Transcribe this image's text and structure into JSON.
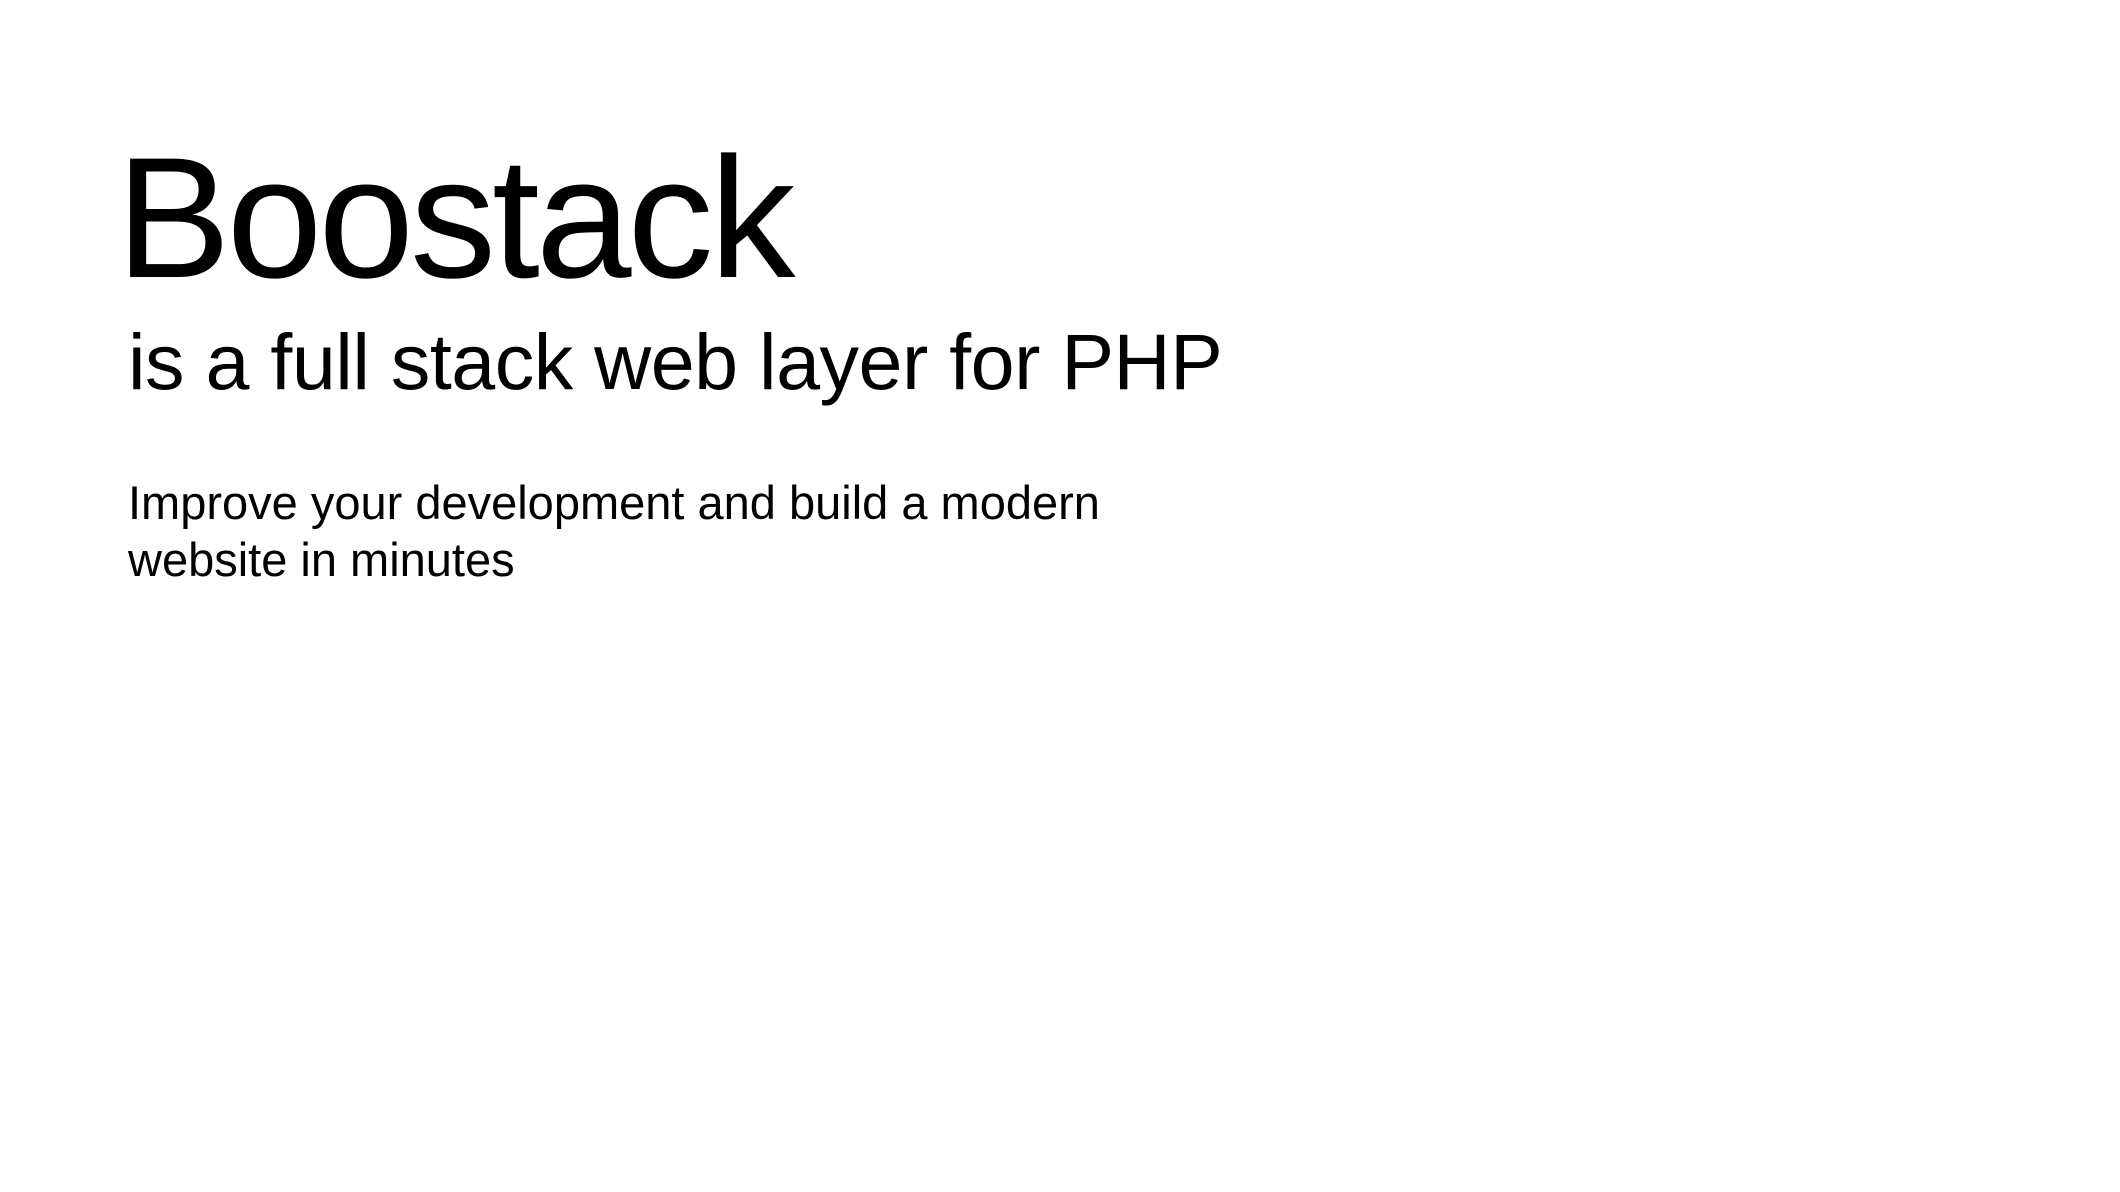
{
  "slide": {
    "title": "Boostack",
    "tagline": "is a full stack web layer for PHP",
    "description_lines": [
      "Improve your development and build a modern",
      "website in minutes"
    ]
  },
  "colors": {
    "background": "#ffffff",
    "text": "#000000"
  }
}
